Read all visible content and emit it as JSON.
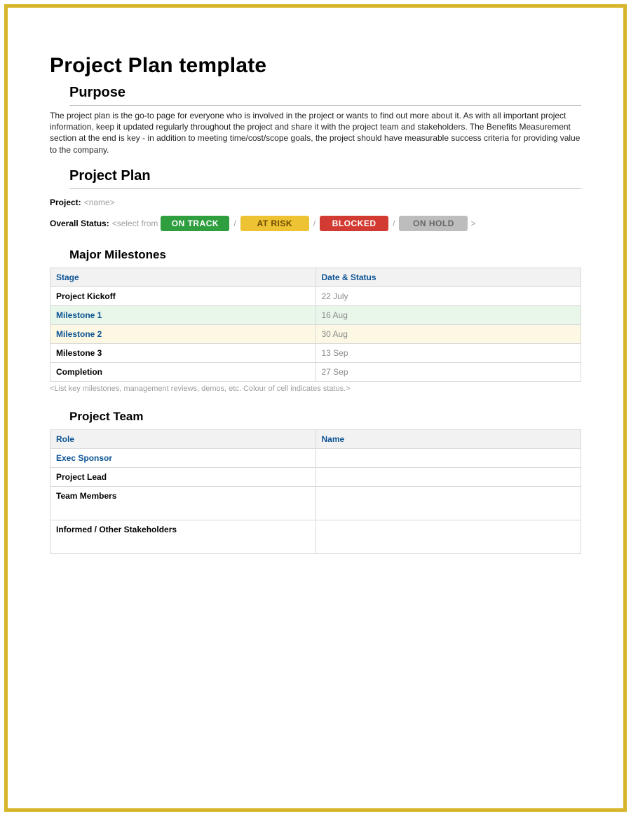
{
  "title": "Project Plan template",
  "sections": {
    "purpose": {
      "heading": "Purpose",
      "body": "The project plan is the go-to page for everyone who is involved in the project or wants to find out more about it.   As with all important project information, keep it updated regularly throughout the project and share it with the project team and stakeholders.   The Benefits Measurement section at the end is key - in addition to meeting time/cost/scope goals, the project should have measurable success criteria for providing value to the company."
    },
    "plan": {
      "heading": "Project Plan",
      "project_label": "Project:",
      "project_placeholder": "<name>",
      "overall_label": "Overall Status:",
      "overall_placeholder": "<select from",
      "statuses": [
        {
          "label": "ON TRACK",
          "class": "pill-green"
        },
        {
          "label": "AT RISK",
          "class": "pill-yellow"
        },
        {
          "label": "BLOCKED",
          "class": "pill-red"
        },
        {
          "label": "ON HOLD",
          "class": "pill-gray"
        }
      ],
      "close_bracket": ">",
      "sep": "/"
    },
    "milestones": {
      "heading": "Major Milestones",
      "col1": "Stage",
      "col2": "Date & Status",
      "rows": [
        {
          "stage": "Project Kickoff",
          "stage_class": "cell-strong",
          "date": "22 July",
          "row_class": ""
        },
        {
          "stage": "Milestone 1",
          "stage_class": "cell-link",
          "date": "16 Aug",
          "row_class": "row-green"
        },
        {
          "stage": "Milestone 2",
          "stage_class": "cell-link",
          "date": "30 Aug",
          "row_class": "row-yellow"
        },
        {
          "stage": "Milestone 3",
          "stage_class": "cell-strong",
          "date": "13 Sep",
          "row_class": ""
        },
        {
          "stage": "Completion",
          "stage_class": "cell-strong",
          "date": "27 Sep",
          "row_class": ""
        }
      ],
      "note": "<List key milestones, management reviews, demos, etc.  Colour of cell indicates status.>"
    },
    "team": {
      "heading": "Project Team",
      "col1": "Role",
      "col2": "Name",
      "rows": [
        {
          "role": "Exec Sponsor",
          "role_class": "cell-link",
          "name": "",
          "tall": false
        },
        {
          "role": "Project Lead",
          "role_class": "cell-strong",
          "name": "",
          "tall": false
        },
        {
          "role": "Team Members",
          "role_class": "cell-strong",
          "name": "",
          "tall": true
        },
        {
          "role": "Informed / Other Stakeholders",
          "role_class": "cell-strong",
          "name": "",
          "tall": true
        }
      ]
    }
  }
}
